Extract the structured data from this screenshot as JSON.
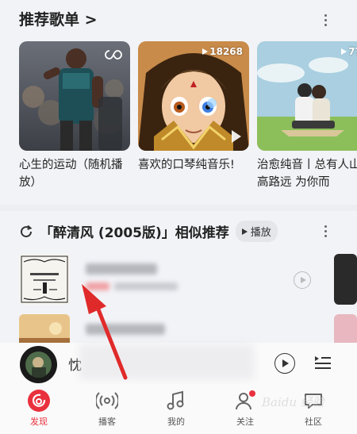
{
  "section1": {
    "title": "推荐歌单 >",
    "cards": [
      {
        "desc": "心生的运动（随机播放）",
        "play_count": ""
      },
      {
        "desc": "喜欢的口琴纯音乐!",
        "play_count": "18268"
      },
      {
        "desc": "治愈纯音丨总有人山高路远 为你而",
        "play_count": "77"
      }
    ]
  },
  "section2": {
    "title": "「醉清风 (2005版)」相似推荐",
    "play_label": "播放"
  },
  "mini_player": {
    "title_fragment": "忱"
  },
  "tabs": [
    {
      "label": "发现",
      "icon": "discover-icon",
      "active": true
    },
    {
      "label": "播客",
      "icon": "podcast-icon",
      "active": false
    },
    {
      "label": "我的",
      "icon": "music-note-icon",
      "active": false
    },
    {
      "label": "关注",
      "icon": "follow-icon",
      "active": false
    },
    {
      "label": "社区",
      "icon": "community-icon",
      "active": false
    }
  ],
  "watermark": "Baidu 经验",
  "colors": {
    "accent": "#e9313d",
    "background": "#f2f3f7"
  }
}
